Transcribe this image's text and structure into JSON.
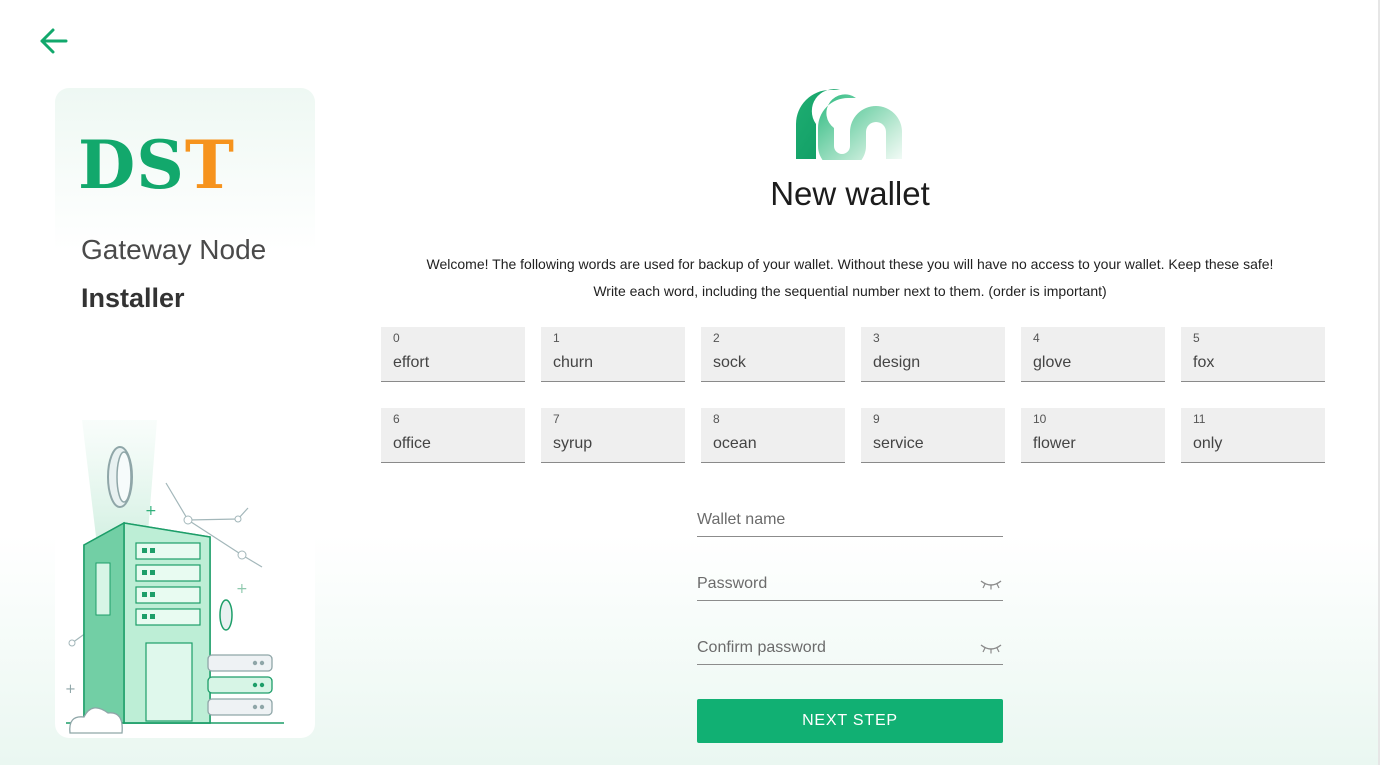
{
  "navigation": {
    "back_icon": "arrow-left-icon"
  },
  "branding": {
    "logo_part1": "DS",
    "logo_part2": "T",
    "product_line1": "Gateway Node",
    "product_line2": "Installer",
    "colors": {
      "green": "#12a86c",
      "orange": "#f6931d"
    }
  },
  "main": {
    "title": "New wallet",
    "intro_line1": "Welcome! The following words are used for backup of your wallet. Without these you will have no access to your wallet. Keep these safe!",
    "intro_line2": "Write each word, including the sequential number next to them. (order is important)",
    "seed_words": [
      {
        "index": "0",
        "word": "effort"
      },
      {
        "index": "1",
        "word": "churn"
      },
      {
        "index": "2",
        "word": "sock"
      },
      {
        "index": "3",
        "word": "design"
      },
      {
        "index": "4",
        "word": "glove"
      },
      {
        "index": "5",
        "word": "fox"
      },
      {
        "index": "6",
        "word": "office"
      },
      {
        "index": "7",
        "word": "syrup"
      },
      {
        "index": "8",
        "word": "ocean"
      },
      {
        "index": "9",
        "word": "service"
      },
      {
        "index": "10",
        "word": "flower"
      },
      {
        "index": "11",
        "word": "only"
      }
    ],
    "form": {
      "wallet_name_placeholder": "Wallet name",
      "password_placeholder": "Password",
      "confirm_password_placeholder": "Confirm password",
      "wallet_name_value": "",
      "password_value": "",
      "confirm_password_value": ""
    },
    "next_label": "NEXT STEP",
    "accent_color": "#11b073"
  }
}
